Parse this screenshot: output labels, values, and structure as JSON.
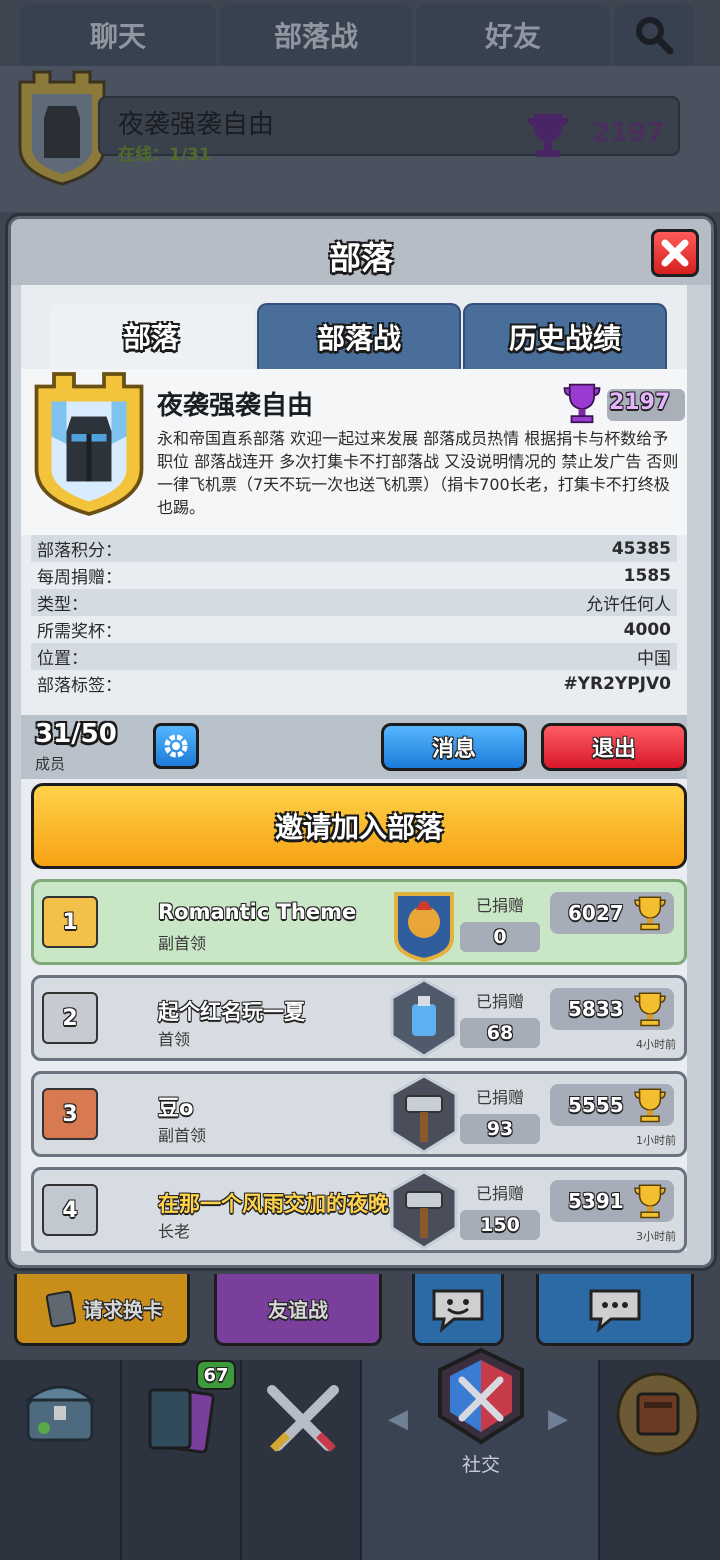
{
  "top_tabs": [
    "聊天",
    "部落战",
    "好友"
  ],
  "clan_bar": {
    "name": "夜袭强袭自由",
    "online": "在线：1/31",
    "trophies": "2197"
  },
  "modal": {
    "title": "部落",
    "tabs": [
      "部落",
      "部落战",
      "历史战绩"
    ],
    "clan": {
      "name": "夜袭强袭自由",
      "trophies": "2197",
      "description": "永和帝国直系部落 欢迎一起过来发展 部落成员热情 根据捐卡与杯数给予职位 部落战连开 多次打集卡不打部落战 又没说明情况的 禁止发广告 否则一律飞机票（7天不玩一次也送飞机票）（捐卡700长老，打集卡不打终极也踢。"
    },
    "stats": [
      {
        "label": "部落积分：",
        "value": "45385"
      },
      {
        "label": "每周捐赠：",
        "value": "1585"
      },
      {
        "label": "类型：",
        "value": "允许任何人"
      },
      {
        "label": "所需奖杯：",
        "value": "4000"
      },
      {
        "label": "位置：",
        "value": "中国"
      },
      {
        "label": "部落标签：",
        "value": "#YR2YPJV0"
      }
    ],
    "members_count": "31/50",
    "members_label": "成员",
    "message_button": "消息",
    "leave_button": "退出",
    "invite_button": "邀请加入部落",
    "donated_label": "已捐赠",
    "members": [
      {
        "rank": "1",
        "name": "Romantic Theme",
        "role": "副首领",
        "donated": "0",
        "trophies": "6027",
        "time": ""
      },
      {
        "rank": "2",
        "name": "起个红名玩一夏",
        "role": "首领",
        "donated": "68",
        "trophies": "5833",
        "time": "4小时前"
      },
      {
        "rank": "3",
        "name": "豆o",
        "role": "副首领",
        "donated": "93",
        "trophies": "5555",
        "time": "1小时前"
      },
      {
        "rank": "4",
        "name": "在那一个风雨交加的夜晚",
        "role": "长老",
        "donated": "150",
        "trophies": "5391",
        "time": "3小时前"
      }
    ]
  },
  "bottom_buttons": {
    "request": "请求换卡",
    "friendly": "友谊战"
  },
  "nav": {
    "cards_badge": "67",
    "social_label": "社交"
  },
  "colors": {
    "accent_blue": "#1c7bd8",
    "accent_red": "#d8182a",
    "accent_yellow": "#f6a214",
    "trophy_purple": "#8a2fb8"
  }
}
